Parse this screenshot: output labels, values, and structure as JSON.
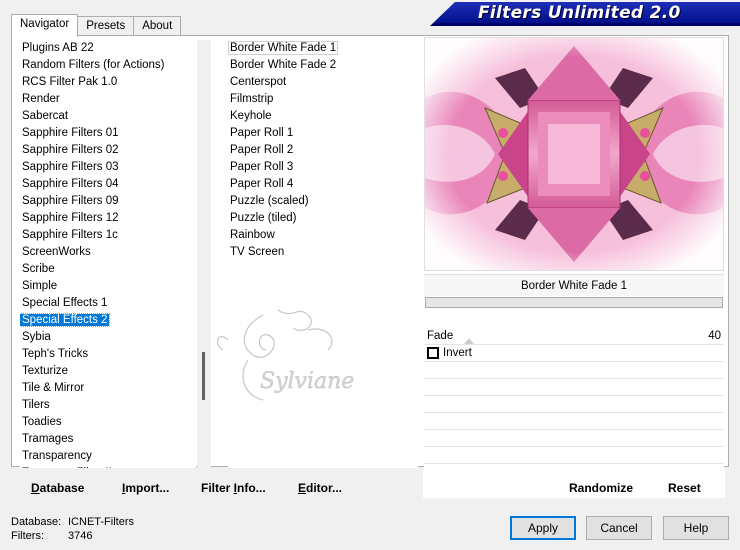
{
  "window": {
    "title": "Filters Unlimited 2.0"
  },
  "tabs": [
    {
      "label": "Navigator",
      "active": true
    },
    {
      "label": "Presets",
      "active": false
    },
    {
      "label": "About",
      "active": false
    }
  ],
  "categories": {
    "items": [
      "Plugins AB 22",
      "Random Filters (for Actions)",
      "RCS Filter Pak 1.0",
      "Render",
      "Sabercat",
      "Sapphire Filters 01",
      "Sapphire Filters 02",
      "Sapphire Filters 03",
      "Sapphire Filters 04",
      "Sapphire Filters 09",
      "Sapphire Filters 12",
      "Sapphire Filters 1c",
      "ScreenWorks",
      "Scribe",
      "Simple",
      "Special Effects 1",
      "Special Effects 2",
      "Sybia",
      "Teph's Tricks",
      "Texturize",
      "Tile & Mirror",
      "Tilers",
      "Toadies",
      "Tramages",
      "Transparency",
      "Tramages Filter II"
    ],
    "selected": "Special Effects 2",
    "scroll_position": 0.82
  },
  "filters": {
    "items": [
      "Border White Fade 1",
      "Border White Fade 2",
      "Centerspot",
      "Filmstrip",
      "Keyhole",
      "Paper Roll 1",
      "Paper Roll 2",
      "Paper Roll 3",
      "Paper Roll 4",
      "Puzzle (scaled)",
      "Puzzle (tiled)",
      "Rainbow",
      "TV Screen"
    ],
    "selected": "Border White Fade 1"
  },
  "preview": {
    "filter_name": "Border White Fade 1",
    "colors": {
      "pink": "#e86aa8",
      "light_pink": "#f7b6d6",
      "magenta": "#c23a85",
      "gold": "#c8ad6a",
      "dark": "#3a2a2a"
    }
  },
  "parameters": {
    "fade": {
      "label": "Fade",
      "value": "40"
    },
    "invert": {
      "label": "Invert",
      "checked": false
    }
  },
  "toolbar": {
    "database": {
      "pre": "",
      "key": "D",
      "post": "atabase"
    },
    "import": {
      "pre": "",
      "key": "I",
      "post": "mport..."
    },
    "filter_info": {
      "pre": "Filter ",
      "key": "I",
      "post": "nfo..."
    },
    "editor": {
      "pre": "",
      "key": "E",
      "post": "ditor..."
    },
    "randomize": "Randomize",
    "reset": "Reset"
  },
  "status": {
    "database_label": "Database:",
    "database_value": "ICNET-Filters",
    "filters_label": "Filters:",
    "filters_value": "3746"
  },
  "buttons": {
    "apply": "Apply",
    "cancel": "Cancel",
    "help": "Help"
  },
  "watermark": {
    "text": "Sylviane"
  }
}
